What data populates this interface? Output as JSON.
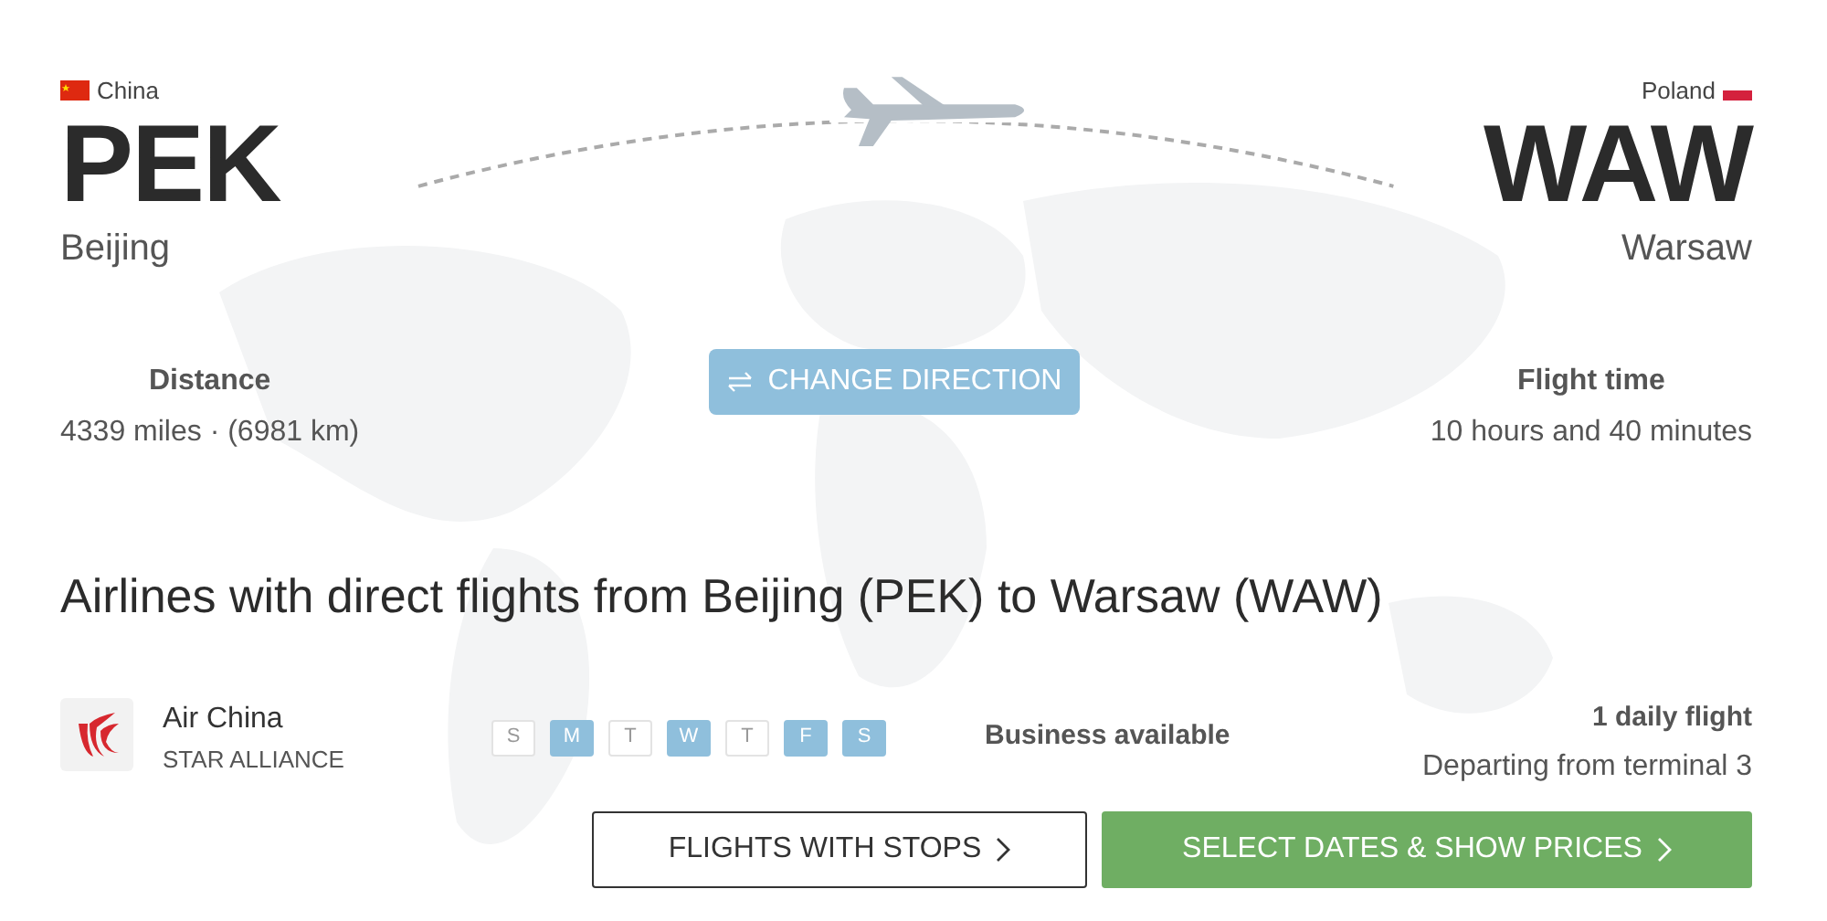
{
  "origin": {
    "country": "China",
    "code": "PEK",
    "city": "Beijing"
  },
  "destination": {
    "country": "Poland",
    "code": "WAW",
    "city": "Warsaw"
  },
  "distance": {
    "label": "Distance",
    "value": "4339 miles · (6981 km)"
  },
  "change_direction": {
    "label": "CHANGE DIRECTION"
  },
  "flight_time": {
    "label": "Flight time",
    "value": "10 hours and 40 minutes"
  },
  "heading": "Airlines with direct flights from Beijing (PEK) to Warsaw (WAW)",
  "airlines": [
    {
      "name": "Air China",
      "alliance": "STAR ALLIANCE",
      "days": [
        {
          "label": "S",
          "selected": false
        },
        {
          "label": "M",
          "selected": true
        },
        {
          "label": "T",
          "selected": false
        },
        {
          "label": "W",
          "selected": true
        },
        {
          "label": "T",
          "selected": false
        },
        {
          "label": "F",
          "selected": true
        },
        {
          "label": "S",
          "selected": true
        }
      ],
      "class": "Business available",
      "frequency": "1 daily flight",
      "terminal": "Departing from terminal 3"
    }
  ],
  "buttons": [
    {
      "label": "FLIGHTS WITH STOPS",
      "kind": "outline"
    },
    {
      "label": "SELECT DATES & SHOW PRICES",
      "kind": "primary"
    }
  ]
}
